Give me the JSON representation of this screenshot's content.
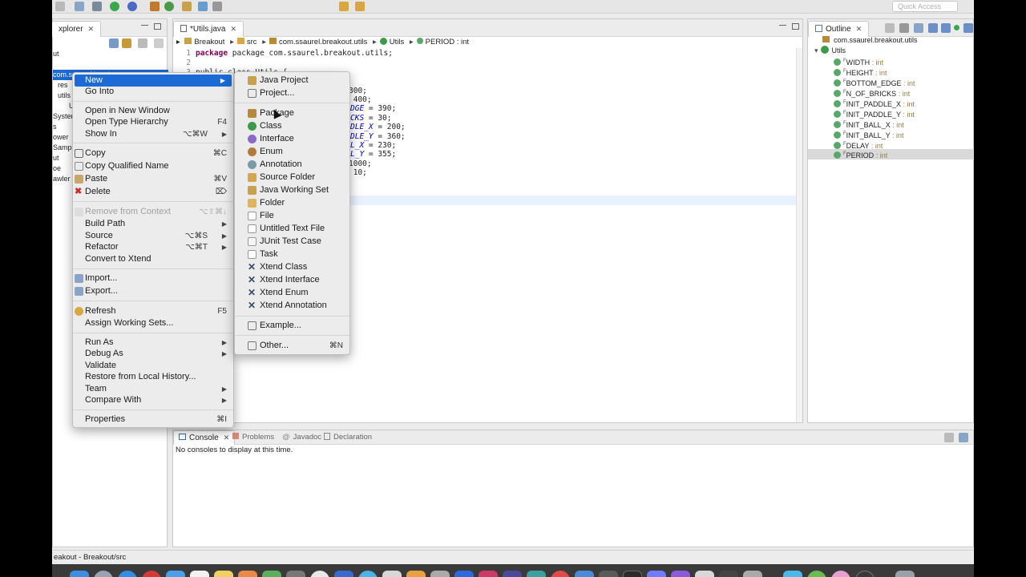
{
  "toolbar": {
    "quick_access": "Quick Access"
  },
  "explorer": {
    "tab_label": "xplorer",
    "rows": [
      "ut",
      "com.ssaurel.breakout",
      "res",
      "utils",
      "U",
      "System",
      "s",
      "ower",
      "Sampl",
      "ut",
      "oe",
      "awler"
    ]
  },
  "editor": {
    "tab_label": "*Utils.java",
    "breadcrumb": [
      "Breakout",
      "src",
      "com.ssaurel.breakout.utils",
      "Utils",
      "PERIOD : int"
    ],
    "code_line_1": {
      "num": "1",
      "text": "package com.ssaurel.breakout.utils;"
    },
    "code_line_2": {
      "num": "2"
    },
    "code_line_3": {
      "num": "3",
      "text": "public class Utils {"
    },
    "code_fragments": [
      {
        "name": "",
        "value": "300;"
      },
      {
        "name": "",
        "value": " 400;"
      },
      {
        "name": "DGE",
        "value": " = 390;"
      },
      {
        "name": "CKS",
        "value": " = 30;"
      },
      {
        "name": "DLE_X",
        "value": " = 200;"
      },
      {
        "name": "DLE_Y",
        "value": " = 360;"
      },
      {
        "name": "L_X",
        "value": " = 230;"
      },
      {
        "name": "L_Y",
        "value": " = 355;"
      },
      {
        "name": "",
        "value": "1000;"
      },
      {
        "name": "",
        "value": " 10;"
      }
    ]
  },
  "outline": {
    "tab_label": "Outline",
    "package": "com.ssaurel.breakout.utils",
    "class_name": "Utils",
    "fields": [
      {
        "name": "WIDTH",
        "type": " : int"
      },
      {
        "name": "HEIGHT",
        "type": " : int"
      },
      {
        "name": "BOTTOM_EDGE",
        "type": " : int"
      },
      {
        "name": "N_OF_BRICKS",
        "type": " : int"
      },
      {
        "name": "INIT_PADDLE_X",
        "type": " : int"
      },
      {
        "name": "INIT_PADDLE_Y",
        "type": " : int"
      },
      {
        "name": "INIT_BALL_X",
        "type": " : int"
      },
      {
        "name": "INIT_BALL_Y",
        "type": " : int"
      },
      {
        "name": "DELAY",
        "type": " : int"
      },
      {
        "name": "PERIOD",
        "type": " : int"
      }
    ],
    "field_marker": "F"
  },
  "console": {
    "tabs": [
      "Console",
      "Problems",
      "Javadoc",
      "Declaration"
    ],
    "message": "No consoles to display at this time."
  },
  "status": {
    "text": "eakout - Breakout/src"
  },
  "context_menu": {
    "items": [
      {
        "label": "New",
        "arrow": "▶",
        "highlight": true
      },
      {
        "label": "Go Into"
      },
      {
        "label": "Open in New Window"
      },
      {
        "label": "Open Type Hierarchy",
        "shortcut": "F4"
      },
      {
        "label": "Show In",
        "shortcut": "⌥⌘W",
        "arrow": "▶"
      },
      {
        "label": "Copy",
        "shortcut": "⌘C"
      },
      {
        "label": "Copy Qualified Name"
      },
      {
        "label": "Paste",
        "shortcut": "⌘V"
      },
      {
        "label": "Delete",
        "shortcut": "⌦"
      },
      {
        "label": "Remove from Context",
        "shortcut": "⌥⇧⌘↓",
        "disabled": true
      },
      {
        "label": "Build Path",
        "arrow": "▶"
      },
      {
        "label": "Source",
        "shortcut": "⌥⌘S",
        "arrow": "▶"
      },
      {
        "label": "Refactor",
        "shortcut": "⌥⌘T",
        "arrow": "▶"
      },
      {
        "label": "Convert to Xtend"
      },
      {
        "label": "Import..."
      },
      {
        "label": "Export..."
      },
      {
        "label": "Refresh",
        "shortcut": "F5"
      },
      {
        "label": "Assign Working Sets..."
      },
      {
        "label": "Run As",
        "arrow": "▶"
      },
      {
        "label": "Debug As",
        "arrow": "▶"
      },
      {
        "label": "Validate"
      },
      {
        "label": "Restore from Local History..."
      },
      {
        "label": "Team",
        "arrow": "▶"
      },
      {
        "label": "Compare With",
        "arrow": "▶"
      },
      {
        "label": "Properties",
        "shortcut": "⌘I"
      }
    ]
  },
  "new_submenu": {
    "items": [
      {
        "label": "Java Project"
      },
      {
        "label": "Project..."
      },
      {
        "label": "Package"
      },
      {
        "label": "Class"
      },
      {
        "label": "Interface"
      },
      {
        "label": "Enum"
      },
      {
        "label": "Annotation"
      },
      {
        "label": "Source Folder"
      },
      {
        "label": "Java Working Set"
      },
      {
        "label": "Folder"
      },
      {
        "label": "File"
      },
      {
        "label": "Untitled Text File"
      },
      {
        "label": "JUnit Test Case"
      },
      {
        "label": "Task"
      },
      {
        "label": "Xtend Class"
      },
      {
        "label": "Xtend Interface"
      },
      {
        "label": "Xtend Enum"
      },
      {
        "label": "Xtend Annotation"
      },
      {
        "label": "Example..."
      },
      {
        "label": "Other...",
        "shortcut": "⌘N"
      }
    ]
  },
  "colors": {
    "highlight": "#1b6ad6",
    "keyword": "#7f0055",
    "constant": "#0000c0",
    "field_icon": "#59a869",
    "class_icon": "#3d9a4a"
  }
}
